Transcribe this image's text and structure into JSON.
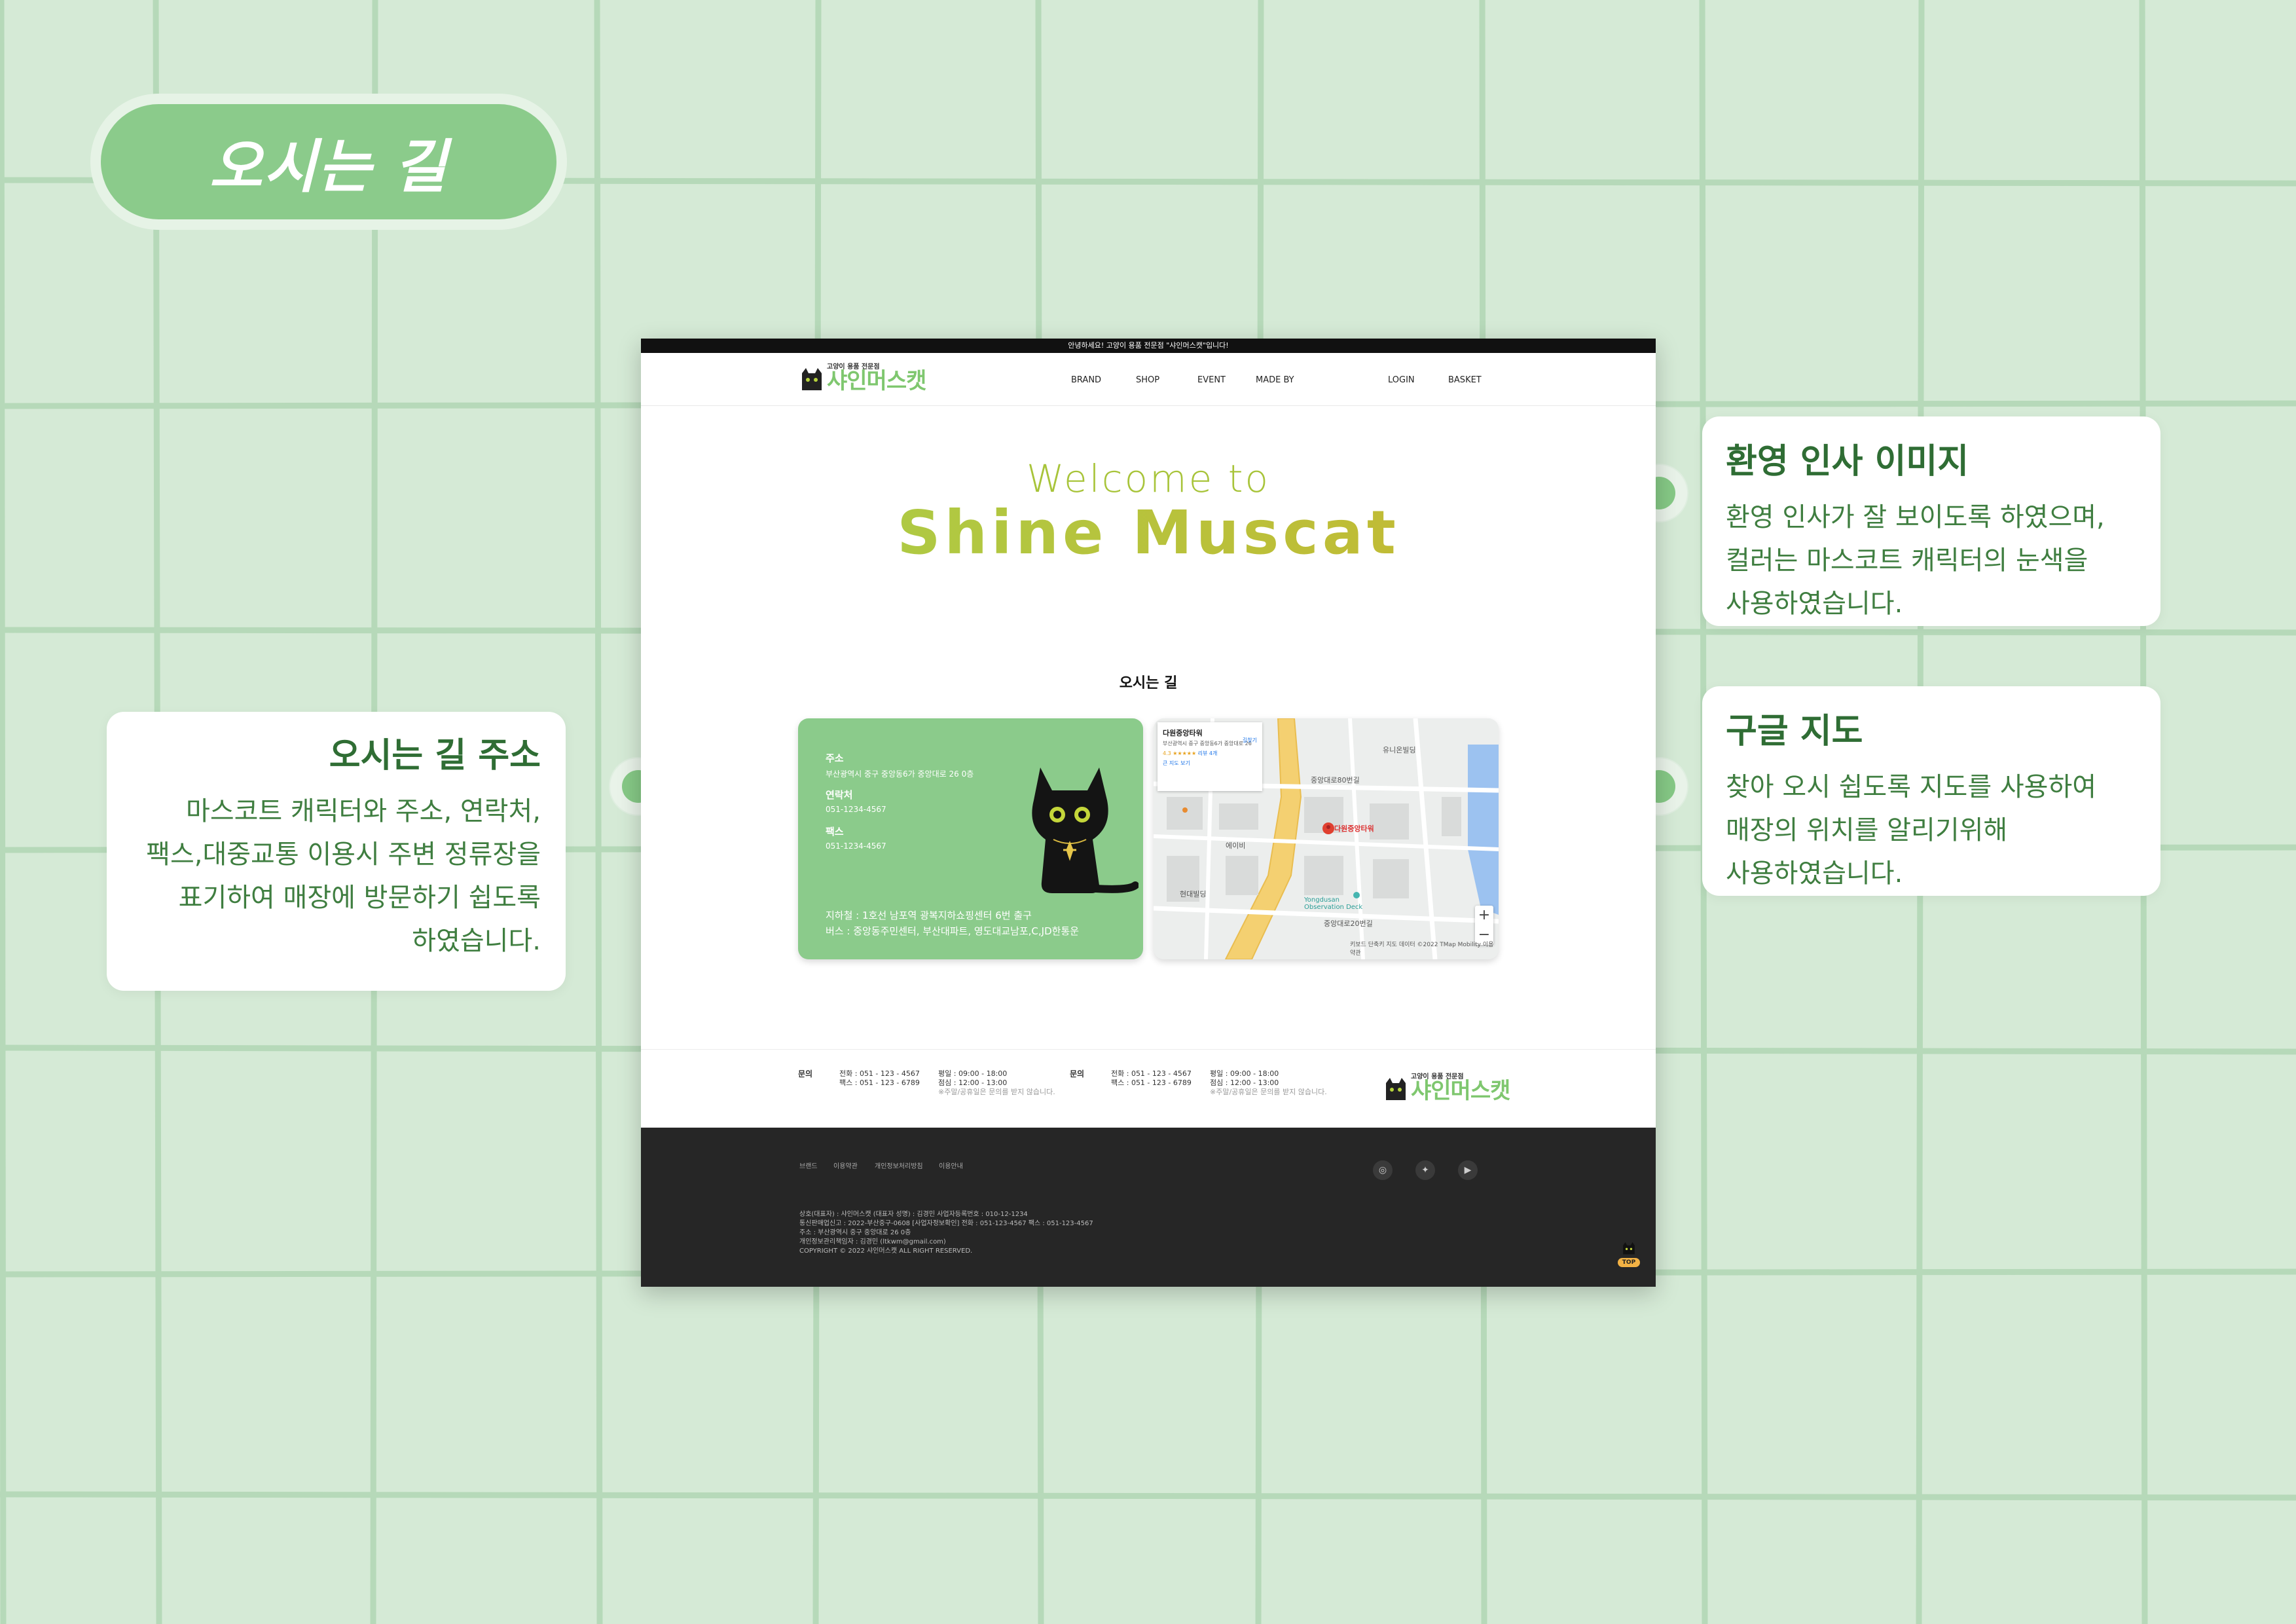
{
  "page_title": "오시는 길",
  "annotations": {
    "left": {
      "title": "오시는 길 주소",
      "body": [
        "마스코트 캐릭터와 주소, 연락처,",
        "팩스,대중교통 이용시 주변 정류장을",
        "표기하여 매장에 방문하기 쉽도록",
        "하였습니다."
      ]
    },
    "right_top": {
      "title": "환영 인사 이미지",
      "body": [
        "환영 인사가 잘 보이도록 하였으며,",
        "컬러는 마스코트 캐릭터의 눈색을",
        "사용하였습니다."
      ]
    },
    "right_bottom": {
      "title": "구글 지도",
      "body": [
        "찾아 오시 쉽도록 지도를 사용하여",
        "매장의 위치를 알리기위해",
        "사용하였습니다."
      ]
    }
  },
  "site": {
    "topbar": "안녕하세요! 고양이 용품 전문점 \"샤인머스캣\"입니다!",
    "logo": {
      "small": "고양이 용품 전문점",
      "big": "샤인머스캣"
    },
    "nav": [
      "BRAND",
      "SHOP",
      "EVENT",
      "MADE BY"
    ],
    "nav_right": [
      "LOGIN",
      "BASKET"
    ],
    "hero": {
      "welcome": "Welcome to",
      "title": "Shine Muscat"
    },
    "section_title": "오시는 길",
    "address_card": {
      "address_label": "주소",
      "address": "부산광역시 중구 중앙동6가 중앙대로 26 0층",
      "phone_label": "연락처",
      "phone": "051-1234-4567",
      "fax_label": "팩스",
      "fax": "051-1234-4567",
      "subway": "지하철 : 1호선 남포역 광복지하쇼핑센터 6번 출구",
      "bus": "버스 : 중앙동주민센터, 부산대파트, 영도대교남포,C,JD한통운"
    },
    "map": {
      "place_name": "다원중앙타워",
      "place_address": "부산광역시 중구 중앙동6가 중앙대로 26",
      "rating": "4.3 ★★★★★",
      "reviews": "리뷰 4개",
      "larger_map": "큰 지도 보기",
      "directions": "길찾기",
      "marker_label": "다원중앙타워",
      "labels": [
        "유니온빌딩",
        "현대빌딩",
        "중앙대로80번길",
        "중앙대로20번길",
        "Yongdusan Observation Deck",
        "에이비"
      ],
      "credit": "키보드 단축키  지도 데이터 ©2022 TMap Mobility  이용약관",
      "zoom_in": "+",
      "zoom_out": "−"
    },
    "footer_info": [
      {
        "head": "문의",
        "phone": "전화 : 051 - 123 - 4567",
        "fax": "팩스 : 051 - 123 - 6789",
        "hours": "평일 : 09:00 - 18:00",
        "lunch": "점심 : 12:00 - 13:00",
        "note": "※주말/공휴일은 문의를 받지 않습니다."
      },
      {
        "head": "문의",
        "phone": "전화 : 051 - 123 - 4567",
        "fax": "팩스 : 051 - 123 - 6789",
        "hours": "평일 : 09:00 - 18:00",
        "lunch": "점심 : 12:00 - 13:00",
        "note": "※주말/공휴일은 문의를 받지 않습니다."
      }
    ],
    "footer_links": [
      "브랜드",
      "이용약관",
      "개인정보처리방침",
      "이용안내"
    ],
    "company_lines": [
      "상호(대표자) : 샤인머스캣 (대표자 성명) : 김경민  사업자등록번호 : 010-12-1234",
      "통신판매업신고 : 2022-부산중구-0608 [사업자정보확인] 전화 : 051-123-4567 팩스 : 051-123-4567",
      "주소 : 부산광역시 중구 중앙대로 26 0층",
      "개인정보관리책임자 : 김경민 (ltkwm@gmail.com)",
      "COPYRIGHT © 2022 샤인머스캣 ALL RIGHT RESERVED."
    ],
    "sns_icons": [
      "instagram-icon",
      "twitter-icon",
      "youtube-icon"
    ],
    "top_button": "TOP"
  }
}
